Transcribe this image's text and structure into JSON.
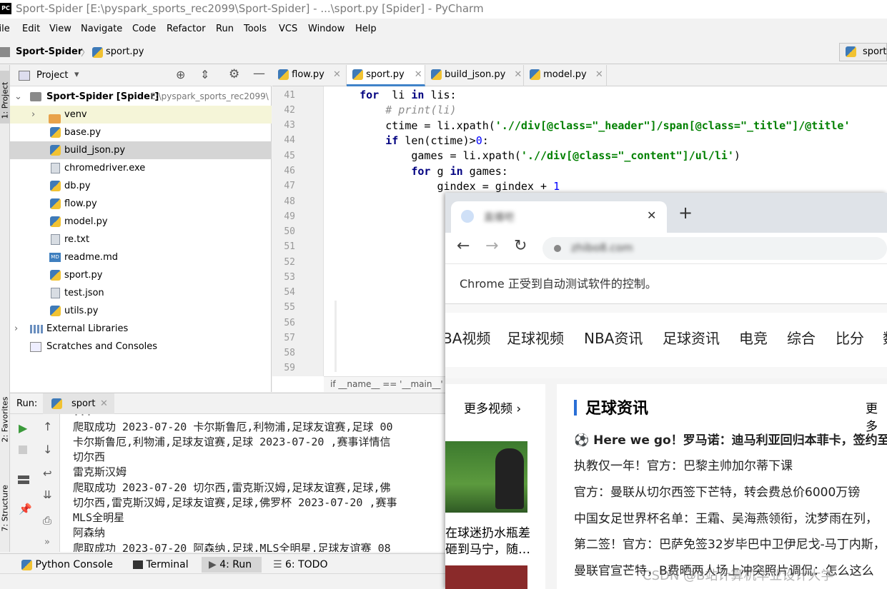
{
  "window": {
    "title": "Sport-Spider [E:\\pyspark_sports_rec2099\\Sport-Spider] - ...\\sport.py [Spider] - PyCharm",
    "app_icon": "PC"
  },
  "menu": [
    "File",
    "Edit",
    "View",
    "Navigate",
    "Code",
    "Refactor",
    "Run",
    "Tools",
    "VCS",
    "Window",
    "Help"
  ],
  "nav": {
    "project": "Sport-Spider",
    "file": "sport.py",
    "run_config": "sport"
  },
  "project_panel": {
    "title": "Project",
    "root": {
      "name": "Sport-Spider [Spider]",
      "path": "E:\\pyspark_sports_rec2099\\"
    },
    "items": [
      "venv",
      "base.py",
      "build_json.py",
      "chromedriver.exe",
      "db.py",
      "flow.py",
      "model.py",
      "re.txt",
      "readme.md",
      "sport.py",
      "test.json",
      "utils.py"
    ],
    "external": "External Libraries",
    "scratches": "Scratches and Consoles"
  },
  "side_labels": {
    "project": "1: Project",
    "favorites": "2: Favorites",
    "structure": "7: Structure"
  },
  "tabs": [
    "flow.py",
    "sport.py",
    "build_json.py",
    "model.py"
  ],
  "editor": {
    "line_numbers": [
      "41",
      "42",
      "43",
      "44",
      "45",
      "46",
      "47",
      "48",
      "49",
      "50",
      "51",
      "52",
      "53",
      "54",
      "55",
      "56",
      "57",
      "58",
      "59"
    ],
    "lines": [
      {
        "indent": "    ",
        "parts": [
          [
            "kw",
            "for"
          ],
          [
            "",
            "  li "
          ],
          [
            "kw",
            "in"
          ],
          [
            "",
            " lis:"
          ]
        ]
      },
      {
        "indent": "        ",
        "parts": [
          [
            "cm",
            "# print(li)"
          ]
        ]
      },
      {
        "indent": "        ",
        "parts": [
          [
            "",
            "ctime = li.xpath("
          ],
          [
            "str",
            "'.//div[@class=\"_header\"]/span[@class=\"_title\"]/@title'"
          ]
        ]
      },
      {
        "indent": "        ",
        "parts": [
          [
            "kw",
            "if"
          ],
          [
            "",
            " len(ctime)>"
          ],
          [
            "num",
            "0"
          ],
          [
            "",
            ":"
          ]
        ]
      },
      {
        "indent": "            ",
        "parts": [
          [
            "",
            "games = li.xpath("
          ],
          [
            "str",
            "'.//div[@class=\"_content\"]/ul/li'"
          ],
          [
            "",
            ")"
          ]
        ]
      },
      {
        "indent": "            ",
        "parts": [
          [
            "kw",
            "for"
          ],
          [
            "",
            " g "
          ],
          [
            "kw",
            "in"
          ],
          [
            "",
            " games:"
          ]
        ]
      },
      {
        "indent": "                ",
        "parts": [
          [
            "",
            "gindex = gindex + "
          ],
          [
            "num",
            "1"
          ]
        ]
      }
    ],
    "breadcrumb": "if __name__ == '__main__'"
  },
  "run": {
    "label": "Run:",
    "tab": "sport",
    "console": [
      "爬取成功 2023-07-20 卡尔斯鲁厄,利物浦,足球友谊赛,足球 00",
      "卡尔斯鲁厄,利物浦,足球友谊赛,足球 2023-07-20 ,赛事详情信",
      "切尔西",
      "雷克斯汉姆",
      "爬取成功 2023-07-20 切尔西,雷克斯汉姆,足球友谊赛,足球,佛",
      "切尔西,雷克斯汉姆,足球友谊赛,足球,佛罗杯 2023-07-20 ,赛事",
      "MLS全明星",
      "阿森纳",
      "爬取成功 2023-07-20 阿森纳,足球,MLS全明星,足球友谊赛 08"
    ]
  },
  "bottom_tools": [
    "Python Console",
    "Terminal",
    "4: Run",
    "6: TODO"
  ],
  "chrome": {
    "tab_title": "直播吧",
    "url": "zhibo8.com",
    "infobar": "Chrome 正受到自动测试软件的控制。",
    "site_nav": [
      "BA视频",
      "足球视频",
      "NBA资讯",
      "足球资讯",
      "电竞",
      "综合",
      "比分",
      "数"
    ],
    "left_more": "更多视频",
    "captions": [
      "在球迷扔水瓶差",
      "砸到马宁，随…"
    ],
    "section_title": "足球资讯",
    "section_more": "更多",
    "news": [
      "⚽ Here we go！罗马诺：迪马利亚回归本菲卡，签约至",
      "执教仅一年！官方：巴黎主帅加尔蒂下课",
      "官方：曼联从切尔西签下芒特，转会费总价6000万镑",
      "中国女足世界杯名单：王霜、吴海燕领衔，沈梦雨在列，",
      "第二签！官方：巴萨免签32岁毕巴中卫伊尼戈-马丁内斯，",
      "曼联官宣芒特，B费晒两人场上冲突照片调侃：怎么这么"
    ]
  },
  "watermark": "CSDN @B站计算机毕业设计大学"
}
